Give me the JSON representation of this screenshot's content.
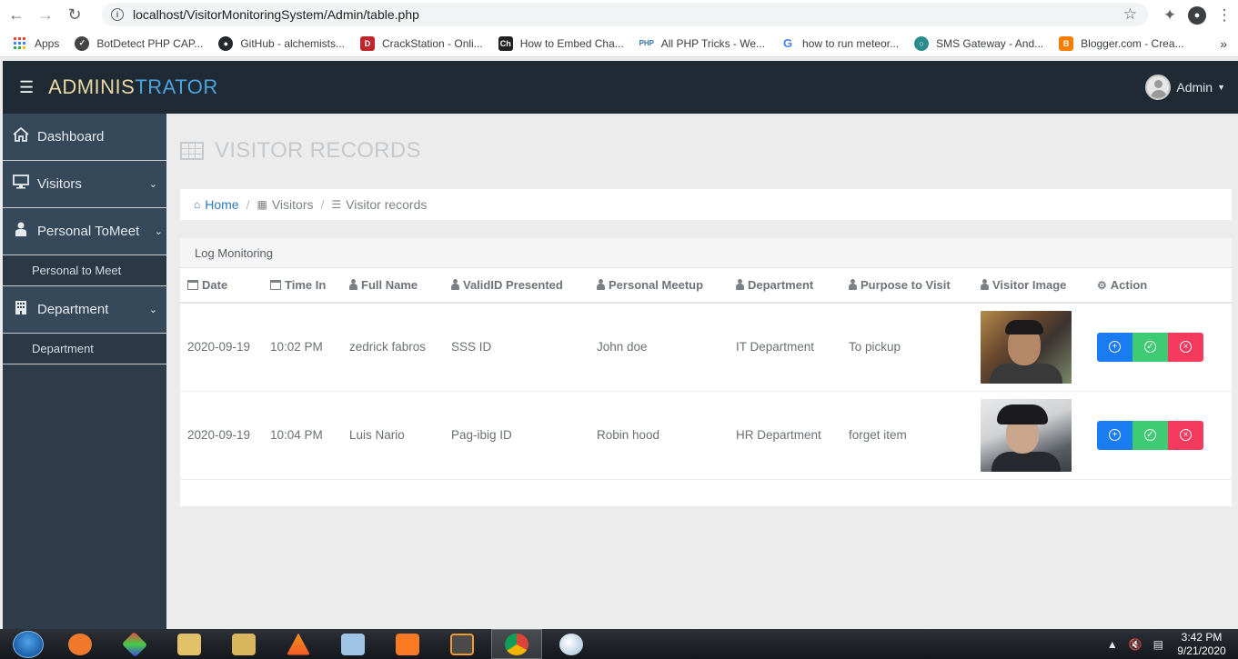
{
  "browser": {
    "url": "localhost/VisitorMonitoringSystem/Admin/table.php",
    "bookmarks": [
      {
        "label": "Apps",
        "icon": "apps-grid-icon",
        "color": "#e8453c"
      },
      {
        "label": "BotDetect PHP CAP...",
        "icon": "botdetect-icon",
        "color": "#444444"
      },
      {
        "label": "GitHub - alchemists...",
        "icon": "github-icon",
        "color": "#24292e"
      },
      {
        "label": "CrackStation - Onli...",
        "icon": "crackstation-icon",
        "color": "#c0262d"
      },
      {
        "label": "How to Embed Cha...",
        "icon": "ch-icon",
        "color": "#222222"
      },
      {
        "label": "All PHP Tricks - We...",
        "icon": "php-icon",
        "color": "#2f6fb3"
      },
      {
        "label": "how to run meteor...",
        "icon": "google-icon",
        "color": "#4285f4"
      },
      {
        "label": "SMS Gateway - And...",
        "icon": "sms-gateway-icon",
        "color": "#2a8c8c"
      },
      {
        "label": "Blogger.com - Crea...",
        "icon": "blogger-icon",
        "color": "#f57d00"
      }
    ]
  },
  "header": {
    "brand_part1": "ADMINIS",
    "brand_part2": "TRATOR",
    "admin_label": "Admin"
  },
  "sidebar": {
    "items": [
      {
        "label": "Dashboard"
      },
      {
        "label": "Visitors"
      },
      {
        "label": "Personal ToMeet",
        "sub": "Personal to Meet"
      },
      {
        "label": "Department",
        "sub": "Department"
      }
    ]
  },
  "page": {
    "title": "VISITOR RECORDS",
    "breadcrumb": [
      "Home",
      "Visitors",
      "Visitor records"
    ],
    "panel_title": "Log Monitoring"
  },
  "table": {
    "headers": [
      "Date",
      "Time In",
      "Full Name",
      "ValidID Presented",
      "Personal Meetup",
      "Department",
      "Purpose to Visit",
      "Visitor Image",
      "Action"
    ],
    "rows": [
      {
        "date": "2020-09-19",
        "time_in": "10:02 PM",
        "full_name": "zedrick fabros",
        "valid_id": "SSS ID",
        "personal_meetup": "John doe",
        "department": "IT Department",
        "purpose": "To pickup"
      },
      {
        "date": "2020-09-19",
        "time_in": "10:04 PM",
        "full_name": "Luis Nario",
        "valid_id": "Pag-ibig ID",
        "personal_meetup": "Robin hood",
        "department": "HR Department",
        "purpose": "forget item"
      }
    ]
  },
  "taskbar": {
    "time": "3:42 PM",
    "date": "9/21/2020"
  },
  "colors": {
    "header_bg": "#1f2a35",
    "sidebar_bg": "#2f3d4a",
    "btn_view": "#1b7bf0",
    "btn_approve": "#3fcb73",
    "btn_delete": "#f43b5d"
  }
}
